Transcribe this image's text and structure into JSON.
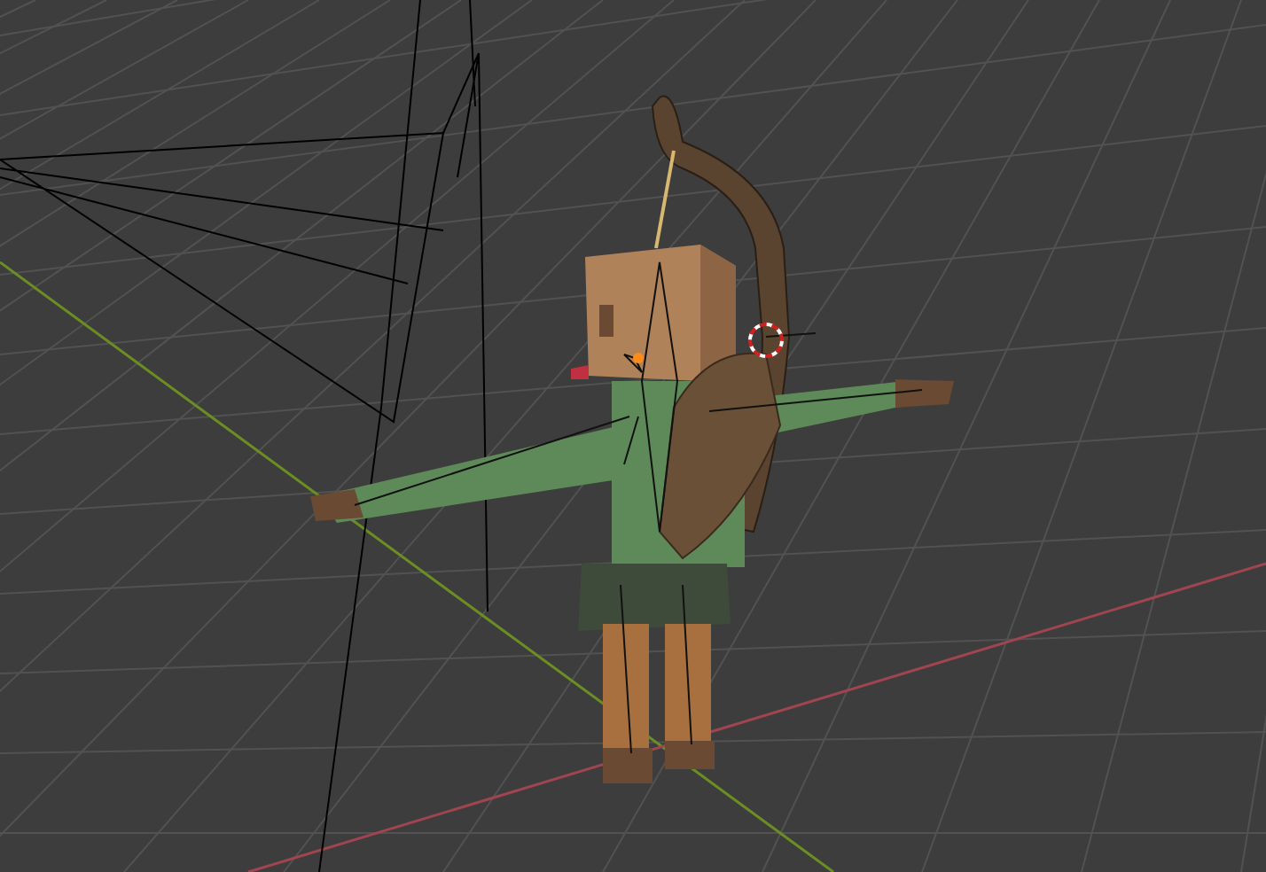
{
  "viewport": {
    "kind": "viewport-3d"
  }
}
